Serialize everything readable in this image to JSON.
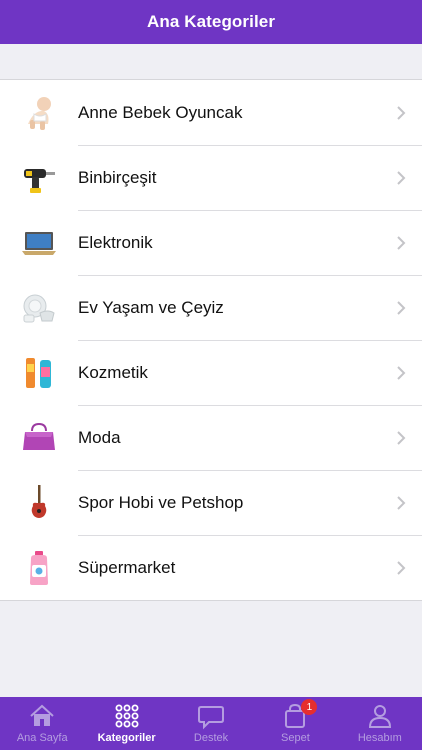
{
  "header": {
    "title": "Ana Kategoriler"
  },
  "categories": [
    {
      "label": "Anne Bebek Oyuncak",
      "icon": "baby-icon"
    },
    {
      "label": "Binbirçeşit",
      "icon": "drill-icon"
    },
    {
      "label": "Elektronik",
      "icon": "laptop-icon"
    },
    {
      "label": "Ev Yaşam ve Çeyiz",
      "icon": "dishes-icon"
    },
    {
      "label": "Kozmetik",
      "icon": "cosmetics-icon"
    },
    {
      "label": "Moda",
      "icon": "bag-icon"
    },
    {
      "label": "Spor Hobi ve Petshop",
      "icon": "guitar-icon"
    },
    {
      "label": "Süpermarket",
      "icon": "detergent-icon"
    }
  ],
  "tabbar": {
    "items": [
      {
        "label": "Ana Sayfa",
        "icon": "home-icon"
      },
      {
        "label": "Kategoriler",
        "icon": "grid-icon"
      },
      {
        "label": "Destek",
        "icon": "chat-icon"
      },
      {
        "label": "Sepet",
        "icon": "bag-icon",
        "badge": "1"
      },
      {
        "label": "Hesabım",
        "icon": "user-icon"
      }
    ],
    "active_index": 1
  },
  "colors": {
    "brand": "#6f35c4",
    "badge": "#e62e2e"
  }
}
